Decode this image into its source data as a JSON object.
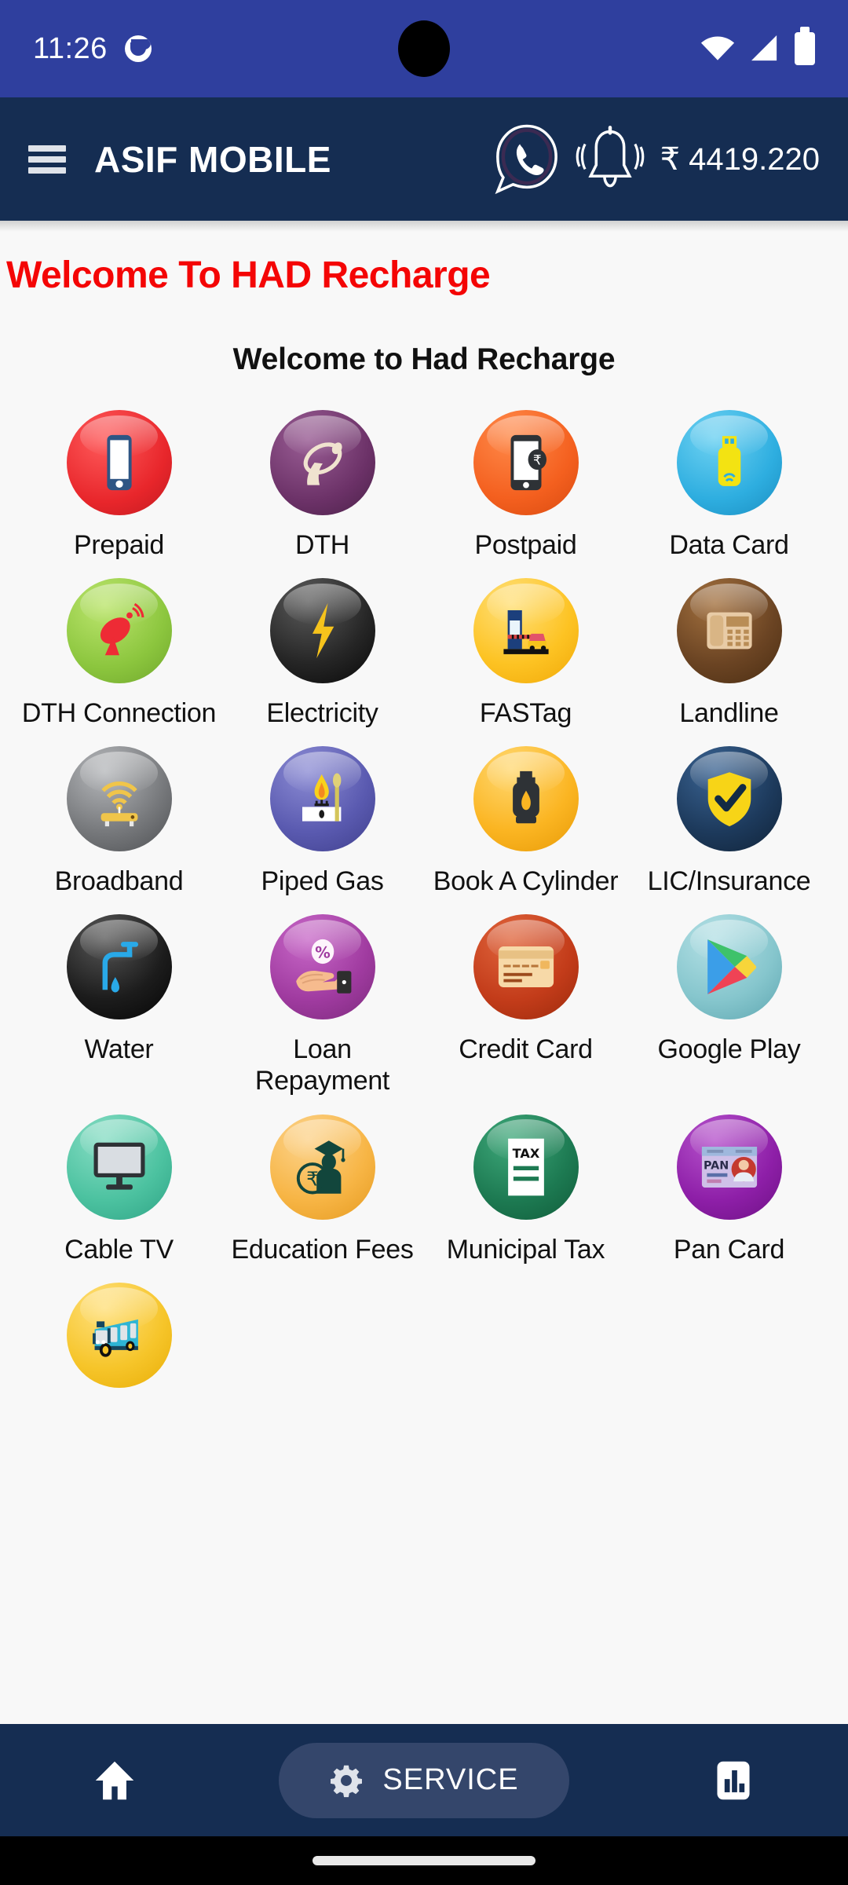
{
  "status_bar": {
    "time": "11:26",
    "app_badge_icon": "app-notification-icon",
    "wifi_icon": "wifi-icon",
    "signal_icon": "cellular-signal-icon",
    "battery_icon": "battery-full-icon"
  },
  "app_bar": {
    "menu_icon": "hamburger-menu-icon",
    "title": "ASIF MOBILE",
    "whatsapp_icon": "whatsapp-call-icon",
    "bell_icon": "notification-bell-icon",
    "balance": "₹ 4419.220",
    "bg_color": "#152d52"
  },
  "content": {
    "banner_text": "Welcome To HAD Recharge",
    "banner_color": "#f40505",
    "heading": "Welcome to Had Recharge"
  },
  "services": [
    {
      "label": "Prepaid",
      "icon": "mobile-phone-icon",
      "bg": "#e8262b"
    },
    {
      "label": "DTH",
      "icon": "satellite-dish-icon",
      "bg": "#6b3167"
    },
    {
      "label": "Postpaid",
      "icon": "phone-rupee-icon",
      "bg": "#f4601f"
    },
    {
      "label": "Data Card",
      "icon": "usb-dongle-icon",
      "bg": "#2eaee0"
    },
    {
      "label": "DTH Connection",
      "icon": "dish-antenna-icon",
      "bg": "#8cc63e"
    },
    {
      "label": "Electricity",
      "icon": "lightning-bolt-icon",
      "bg": "#262626"
    },
    {
      "label": "FASTag",
      "icon": "toll-booth-icon",
      "bg": "#fdc323"
    },
    {
      "label": "Landline",
      "icon": "landline-phone-icon",
      "bg": "#6b4423"
    },
    {
      "label": "Broadband",
      "icon": "wifi-router-icon",
      "bg": "#77797c"
    },
    {
      "label": "Piped Gas",
      "icon": "gas-stove-icon",
      "bg": "#5a5ab0"
    },
    {
      "label": "Book A Cylinder",
      "icon": "gas-cylinder-icon",
      "bg": "#fbb522"
    },
    {
      "label": "LIC/Insurance",
      "icon": "shield-check-icon",
      "bg": "#1d3a5c"
    },
    {
      "label": "Water",
      "icon": "water-tap-icon",
      "bg": "#1c1c1c"
    },
    {
      "label": "Loan Repayment",
      "icon": "hand-percent-icon",
      "bg": "#a03ba0"
    },
    {
      "label": "Credit Card",
      "icon": "credit-card-icon",
      "bg": "#c33c1a"
    },
    {
      "label": "Google Play",
      "icon": "google-play-icon",
      "bg": "#86c6cd"
    },
    {
      "label": "Cable TV",
      "icon": "television-icon",
      "bg": "#4cc2a0"
    },
    {
      "label": "Education Fees",
      "icon": "graduate-rupee-icon",
      "bg": "#f7b545"
    },
    {
      "label": "Municipal Tax",
      "icon": "tax-document-icon",
      "bg": "#1d7a52"
    },
    {
      "label": "Pan Card",
      "icon": "pan-card-icon",
      "bg": "#8e1fa8"
    },
    {
      "label": "",
      "icon": "bus-icon",
      "bg": "#f6c52a"
    }
  ],
  "bottom_nav": {
    "home_icon": "home-icon",
    "service_icon": "gear-icon",
    "service_label": "SERVICE",
    "report_icon": "bar-chart-report-icon",
    "bg_color": "#152d52",
    "pill_color": "#34466b"
  }
}
